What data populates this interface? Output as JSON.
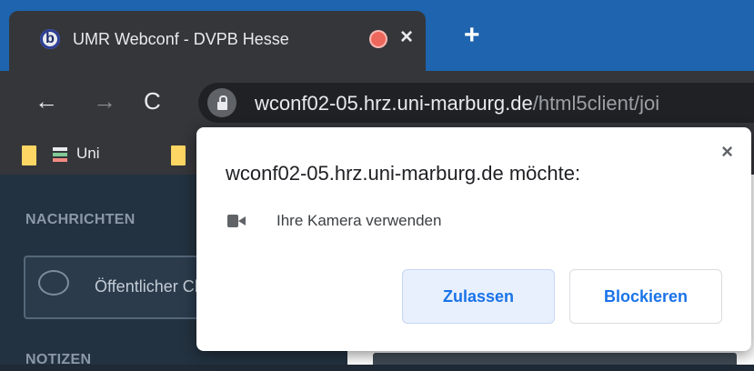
{
  "browser": {
    "tab": {
      "favicon_letter": "b",
      "title": "UMR Webconf - DVPB Hesse",
      "close_glyph": "×"
    },
    "new_tab_glyph": "+",
    "nav": {
      "back_glyph": "←",
      "forward_glyph": "→",
      "reload_glyph": "C"
    },
    "url": {
      "host": "wconf02-05.hrz.uni-marburg.de",
      "path": "/html5client/joi"
    },
    "bookmarks": [
      {
        "label": "Uni"
      }
    ]
  },
  "page": {
    "messages_heading": "NACHRICHTEN",
    "public_chat_label": "Öffentlicher Chat",
    "notes_heading": "NOTIZEN"
  },
  "permission_popup": {
    "close_glyph": "×",
    "origin_text": "wconf02-05.hrz.uni-marburg.de möchte:",
    "permission": {
      "icon": "camera-icon",
      "text": "Ihre Kamera verwenden"
    },
    "allow_label": "Zulassen",
    "block_label": "Blockieren"
  },
  "colors": {
    "tabstrip": "#1e64ae",
    "chrome_dark": "#35363a",
    "accent_blue": "#1a73e8",
    "page_sidebar": "#233240"
  }
}
